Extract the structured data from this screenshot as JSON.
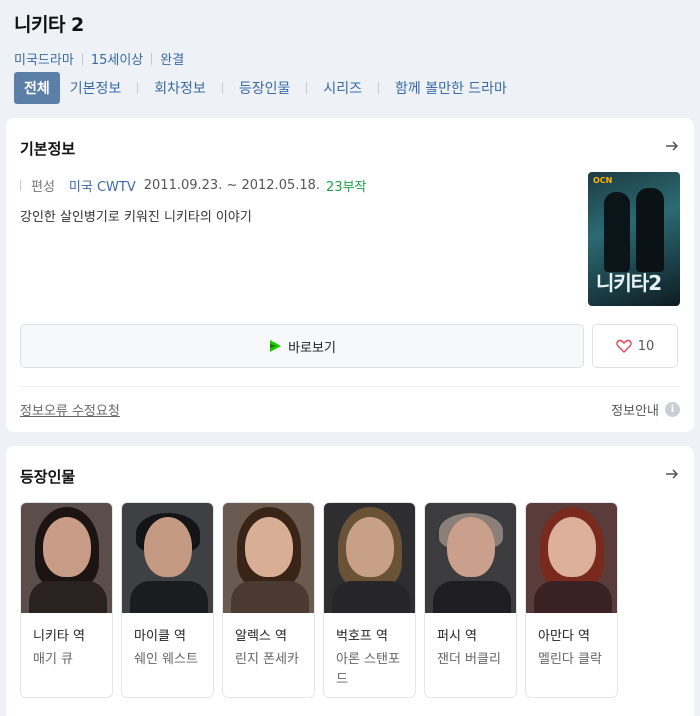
{
  "header": {
    "title": "니키타 2",
    "meta": [
      "미국드라마",
      "15세이상",
      "완결"
    ]
  },
  "tabs": [
    "전체",
    "기본정보",
    "회차정보",
    "등장인물",
    "시리즈",
    "함께 볼만한 드라마"
  ],
  "basic_info": {
    "title": "기본정보",
    "label": "편성",
    "network": "미국 CWTV",
    "dates": "2011.09.23. ~ 2012.05.18.",
    "episodes": "23부작",
    "synopsis": "강인한 살인병기로 키워진 니키타의 이야기",
    "poster": {
      "logo": "OCN",
      "title": "니키타2"
    },
    "watch_label": "바로보기",
    "like_count": "10",
    "report_label": "정보오류 수정요청",
    "guide_label": "정보안내",
    "colors": {
      "link": "#3a6aa6",
      "episodes": "#1aa34a",
      "heart": "#e0475b",
      "play": "#1ec800"
    }
  },
  "cast": {
    "title": "등장인물",
    "members": [
      {
        "role": "니키타 역",
        "actor": "매기 큐"
      },
      {
        "role": "마이클 역",
        "actor": "쉐인 웨스트"
      },
      {
        "role": "알렉스 역",
        "actor": "린지 폰세카"
      },
      {
        "role": "벅호프 역",
        "actor": "아론 스탠포드"
      },
      {
        "role": "퍼시 역",
        "actor": "잰더 버클리"
      },
      {
        "role": "아만다 역",
        "actor": "멜린다 클락"
      }
    ]
  }
}
